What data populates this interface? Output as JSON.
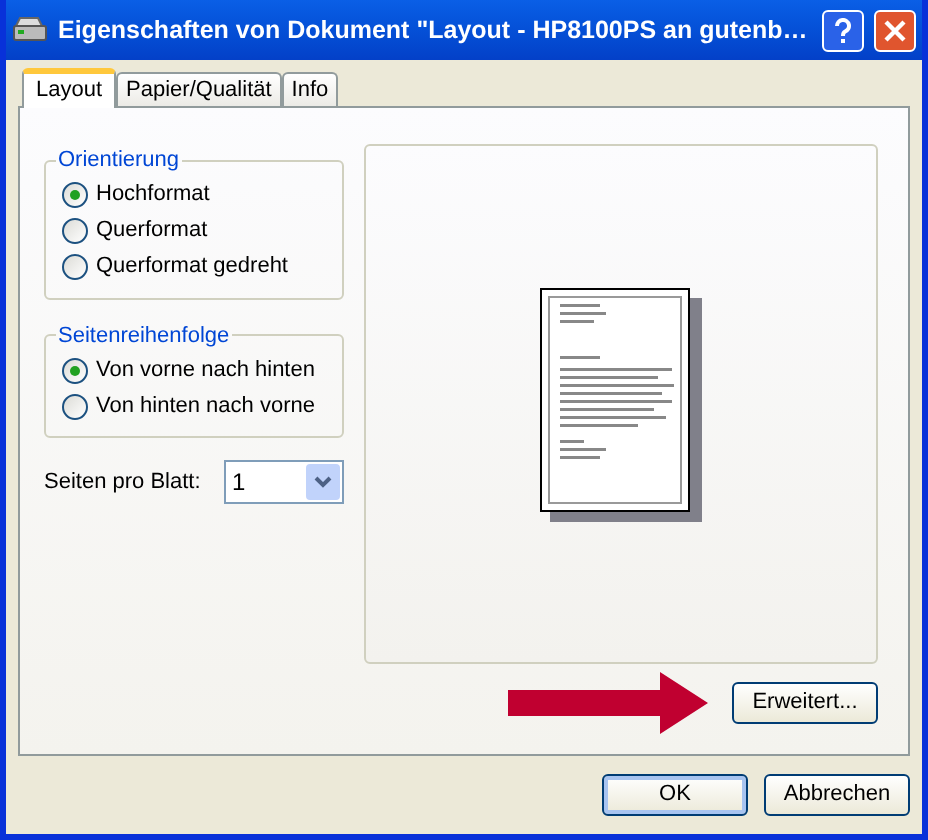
{
  "window": {
    "title": "Eigenschaften von Dokument \"Layout - HP8100PS an gutenb…"
  },
  "tabs": [
    {
      "label": "Layout",
      "selected": true
    },
    {
      "label": "Papier/Qualität",
      "selected": false
    },
    {
      "label": "Info",
      "selected": false
    }
  ],
  "groups": [
    {
      "title": "Orientierung",
      "options": [
        {
          "label": "Hochformat",
          "selected": true
        },
        {
          "label": "Querformat",
          "selected": false
        },
        {
          "label": "Querformat gedreht",
          "selected": false
        }
      ]
    },
    {
      "title": "Seitenreihenfolge",
      "options": [
        {
          "label": "Von vorne nach hinten",
          "selected": true
        },
        {
          "label": "Von hinten nach vorne",
          "selected": false
        }
      ]
    }
  ],
  "pages_per_sheet": {
    "label": "Seiten pro Blatt:",
    "value": "1"
  },
  "advanced_button": "Erweitert...",
  "buttons": [
    {
      "label": "OK",
      "default": true
    },
    {
      "label": "Abbrechen",
      "default": false
    }
  ]
}
